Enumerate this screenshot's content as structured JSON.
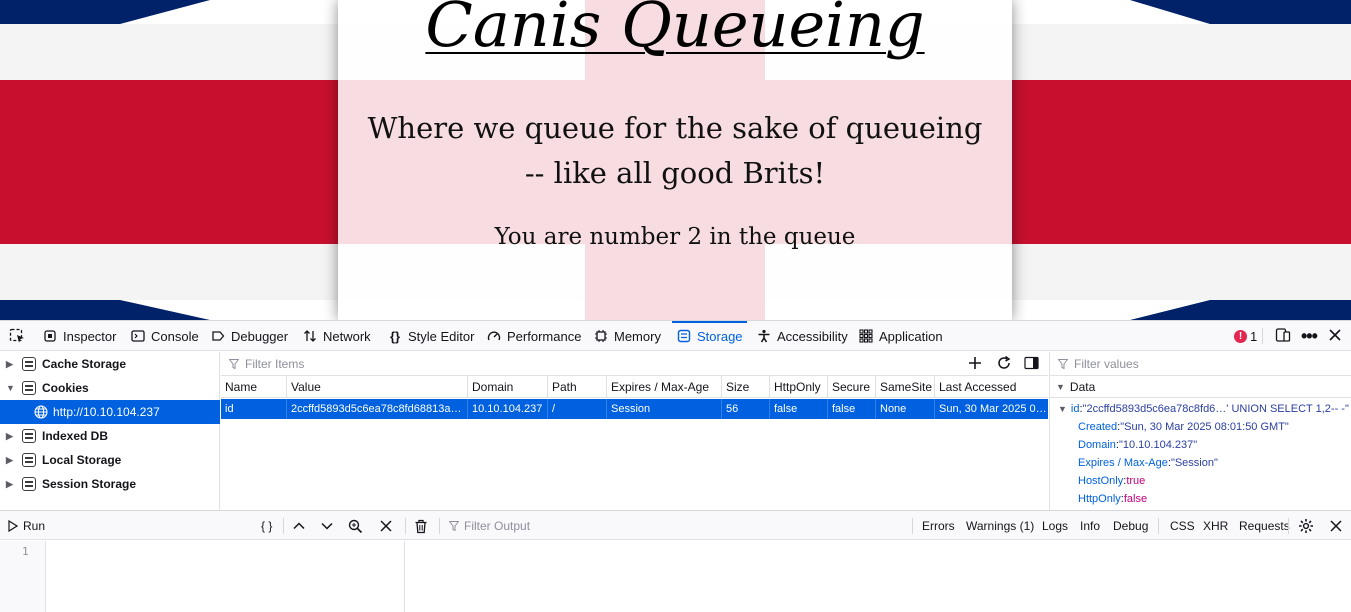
{
  "webpage": {
    "title": "Canis Queueing",
    "tagline_line1": "Where we queue for the sake of queueing",
    "tagline_line2": "-- like all good Brits!",
    "queue_status": "You are number 2 in the queue",
    "colors": {
      "red": "#c8102e",
      "blue": "#012169",
      "white": "#ffffff"
    }
  },
  "devtools": {
    "toolbar": {
      "tabs": [
        {
          "label": "Inspector",
          "icon": "inspector-icon"
        },
        {
          "label": "Console",
          "icon": "console-icon"
        },
        {
          "label": "Debugger",
          "icon": "debugger-icon"
        },
        {
          "label": "Network",
          "icon": "network-icon"
        },
        {
          "label": "Style Editor",
          "icon": "style-editor-icon"
        },
        {
          "label": "Performance",
          "icon": "performance-icon"
        },
        {
          "label": "Memory",
          "icon": "memory-icon"
        },
        {
          "label": "Storage",
          "icon": "storage-icon",
          "active": true
        },
        {
          "label": "Accessibility",
          "icon": "accessibility-icon"
        },
        {
          "label": "Application",
          "icon": "application-icon"
        }
      ],
      "error_count": "1"
    },
    "storage": {
      "tree": [
        {
          "label": "Cache Storage",
          "expanded": false
        },
        {
          "label": "Cookies",
          "expanded": true
        },
        {
          "label": "http://10.10.104.237",
          "selected": true
        },
        {
          "label": "Indexed DB",
          "expanded": false
        },
        {
          "label": "Local Storage",
          "expanded": false
        },
        {
          "label": "Session Storage",
          "expanded": false
        }
      ],
      "filter_placeholder": "Filter Items",
      "columns": [
        "Name",
        "Value",
        "Domain",
        "Path",
        "Expires / Max-Age",
        "Size",
        "HttpOnly",
        "Secure",
        "SameSite",
        "Last Accessed"
      ],
      "row": [
        "id",
        "2ccffd5893d5c6ea78c8fd68813a…",
        "10.10.104.237",
        "/",
        "Session",
        "56",
        "false",
        "false",
        "None",
        "Sun, 30 Mar 2025 0…"
      ],
      "sidebar_filter_placeholder": "Filter values",
      "data_header": "Data",
      "data_items": [
        {
          "key": "id",
          "value": "\"2ccffd5893d5c6ea78c8fd6…' UNION SELECT 1,2-- -\""
        },
        {
          "key": "Created",
          "value": "\"Sun, 30 Mar 2025 08:01:50 GMT\""
        },
        {
          "key": "Domain",
          "value": "\"10.10.104.237\""
        },
        {
          "key": "Expires / Max-Age",
          "value": "\"Session\""
        },
        {
          "key": "HostOnly",
          "value": "true"
        },
        {
          "key": "HttpOnly",
          "value": "false"
        }
      ]
    },
    "console": {
      "run_label": "Run",
      "braces_label": "{ }",
      "filter_placeholder": "Filter Output",
      "filters": [
        "Errors",
        "Warnings (1)",
        "Logs",
        "Info",
        "Debug",
        "CSS",
        "XHR",
        "Requests"
      ],
      "line_number": "1"
    }
  }
}
